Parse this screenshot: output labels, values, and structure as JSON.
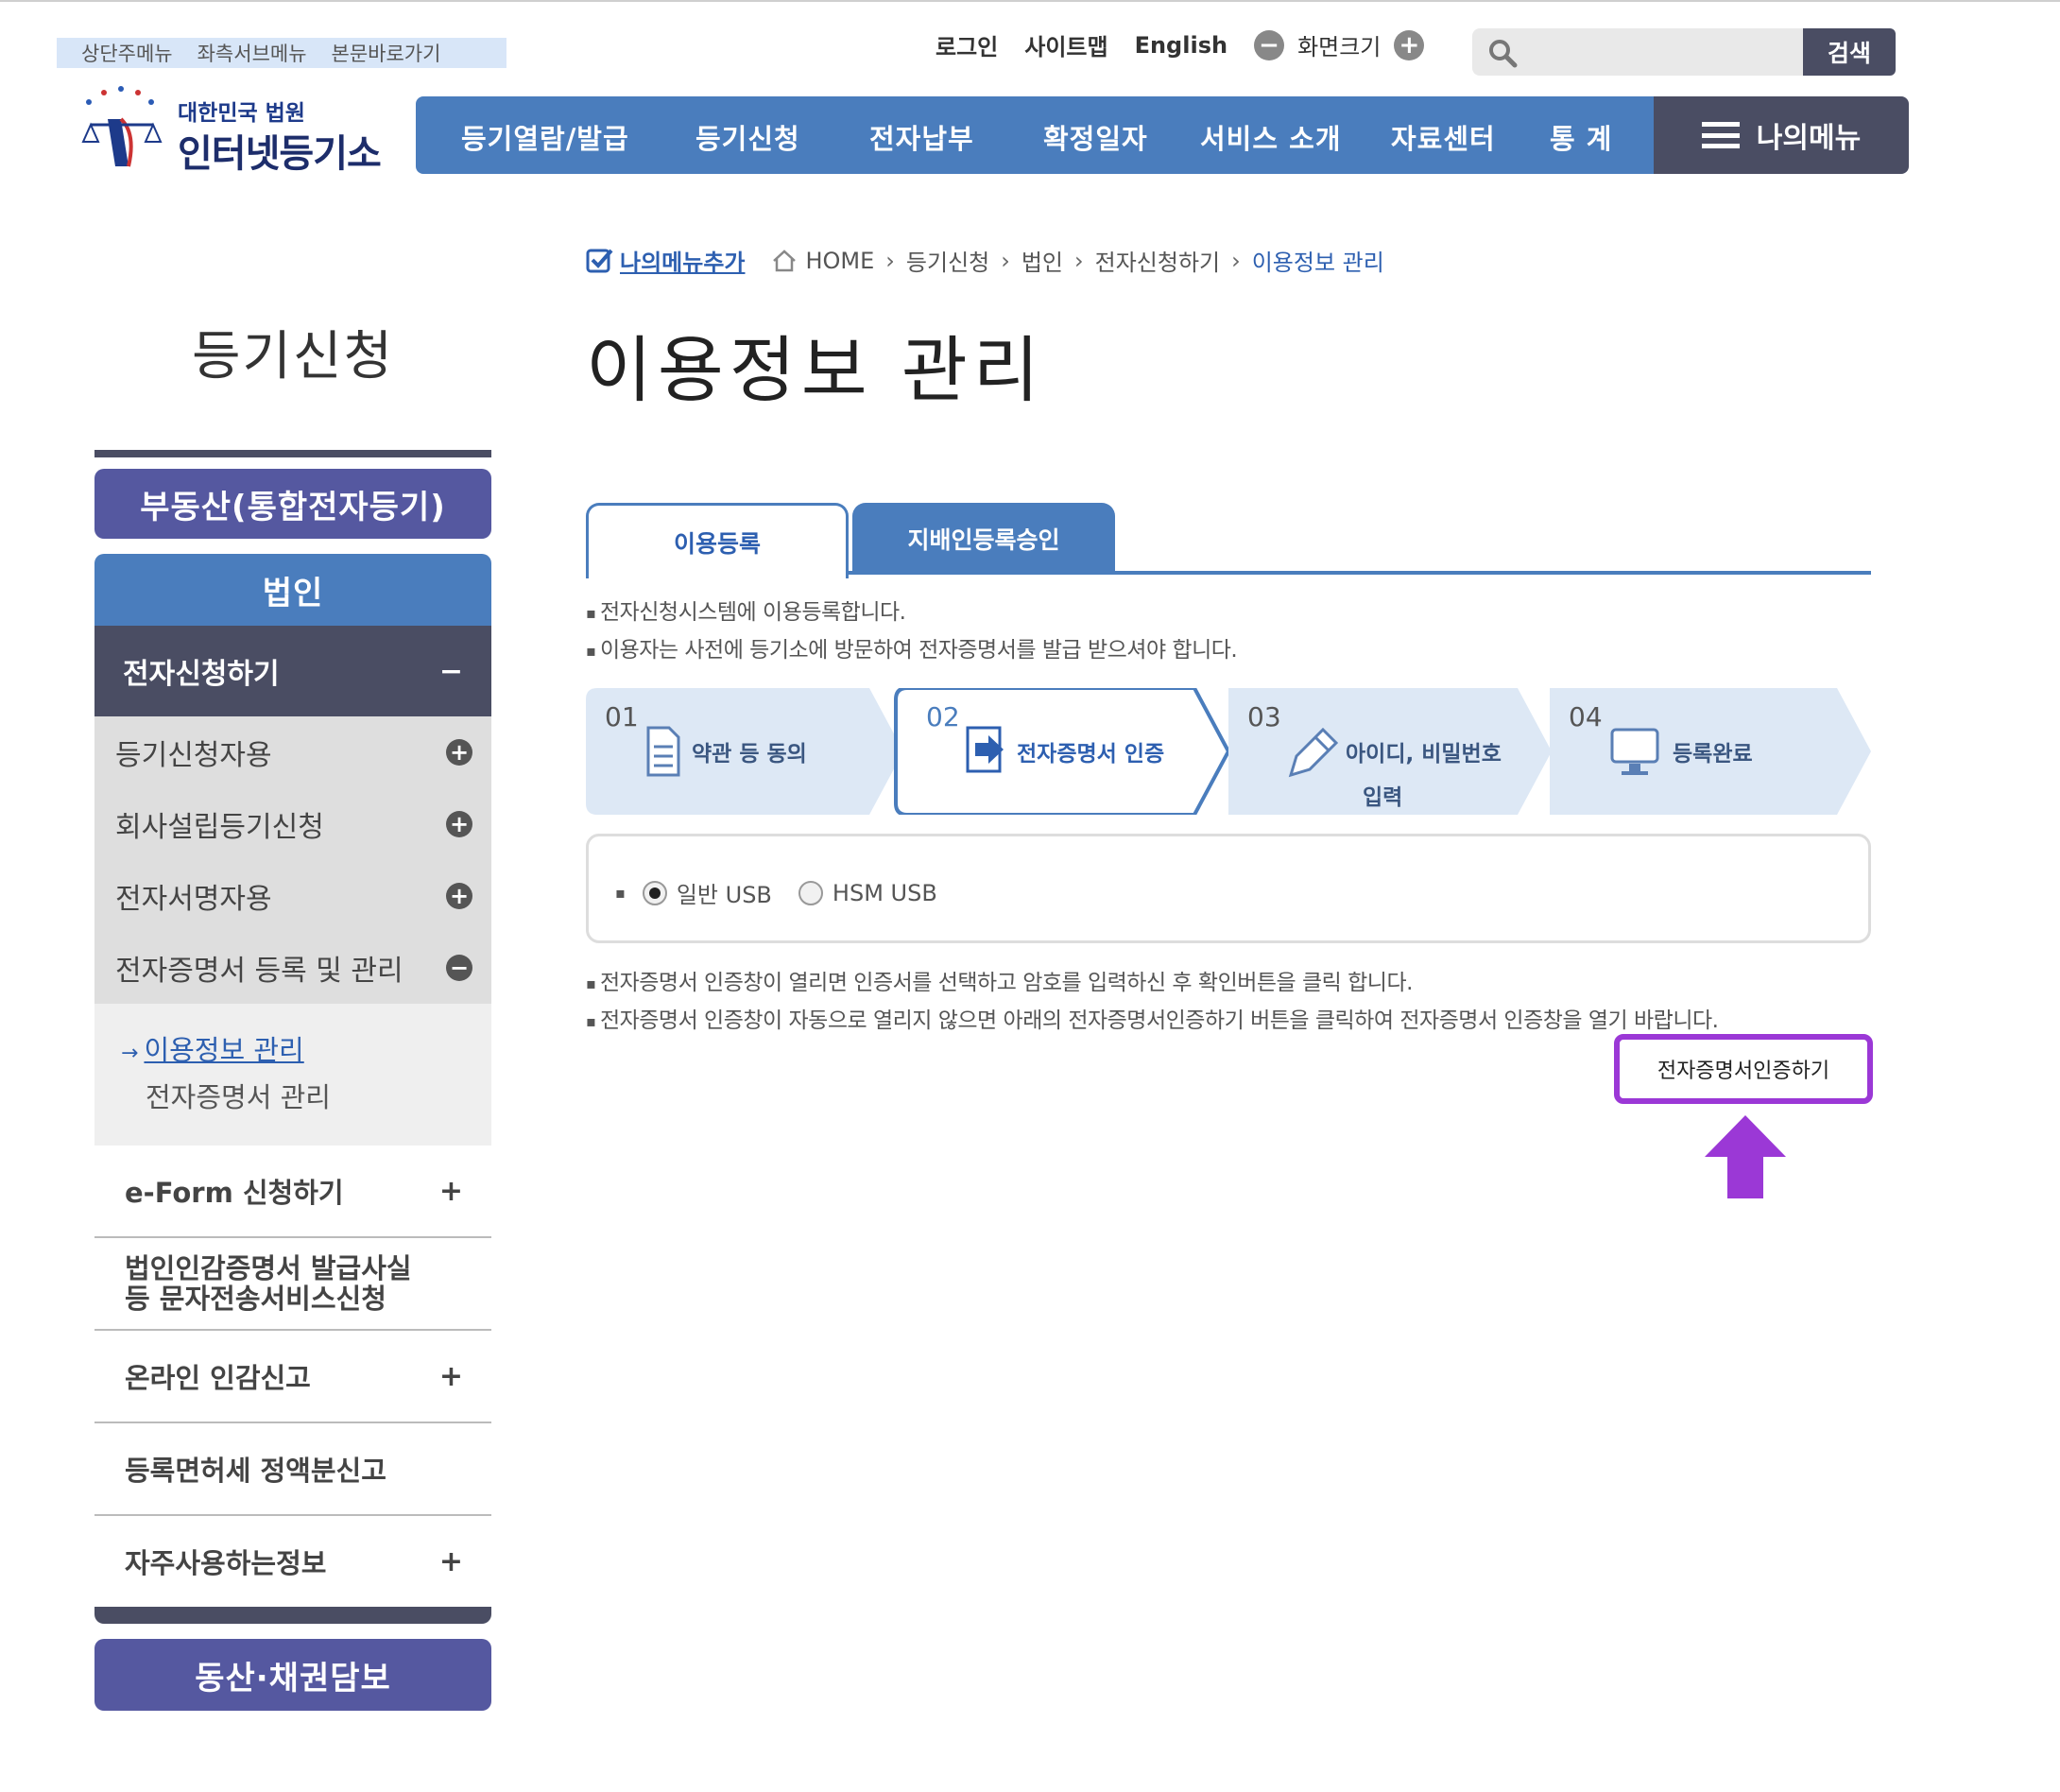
{
  "skip_links": [
    "상단주메뉴",
    "좌측서브메뉴",
    "본문바로가기"
  ],
  "util": {
    "login": "로그인",
    "sitemap": "사이트맵",
    "english": "English",
    "zoom_label": "화면크기",
    "search_button": "검색"
  },
  "logo": {
    "line1": "대한민국 법원",
    "line2": "인터넷등기소"
  },
  "gnb": [
    "등기열람/발급",
    "등기신청",
    "전자납부",
    "확정일자",
    "서비스 소개",
    "자료센터",
    "통 계"
  ],
  "my_menu": "나의메뉴",
  "sidebar": {
    "title": "등기신청",
    "real_estate": "부동산(통합전자등기)",
    "corporation": "법인",
    "expanded": {
      "label": "전자신청하기",
      "toggle": "−"
    },
    "sub_items": [
      "등기신청자용",
      "회사설립등기신청",
      "전자서명자용",
      "전자증명서 등록 및 관리"
    ],
    "leaf_items": [
      "이용정보 관리",
      "전자증명서 관리"
    ],
    "leaf_prefix": "→",
    "menus": [
      {
        "label": "e-Form 신청하기",
        "toggle": "+"
      },
      {
        "label": "법인인감증명서 발급사실 등 문자전송서비스신청",
        "toggle": ""
      },
      {
        "label": "온라인 인감신고",
        "toggle": "+"
      },
      {
        "label": "등록면허세 정액분신고",
        "toggle": ""
      },
      {
        "label": "자주사용하는정보",
        "toggle": "+"
      }
    ],
    "movable": "동산·채권담보"
  },
  "breadcrumb": {
    "add_menu": "나의메뉴추가",
    "items": [
      "HOME",
      "등기신청",
      "법인",
      "전자신청하기"
    ],
    "current": "이용정보 관리"
  },
  "page_title": "이용정보 관리",
  "tabs": [
    "이용등록",
    "지배인등록승인"
  ],
  "notes_top": [
    "전자신청시스템에 이용등록합니다.",
    "이용자는 사전에 등기소에 방문하여 전자증명서를 발급 받으셔야 합니다."
  ],
  "steps": [
    {
      "num": "01",
      "label": "약관 등 동의"
    },
    {
      "num": "02",
      "label": "전자증명서 인증"
    },
    {
      "num": "03",
      "label": "아이디, 비밀번호",
      "label2": "입력"
    },
    {
      "num": "04",
      "label": "등록완료"
    }
  ],
  "usb_options": [
    "일반 USB",
    "HSM USB"
  ],
  "selected_usb": "일반 USB",
  "notes_bottom": [
    "전자증명서 인증창이 열리면 인증서를 선택하고 암호를 입력하신 후 확인버튼을 클릭 합니다.",
    "전자증명서 인증창이 자동으로 열리지 않으면 아래의 전자증명서인증하기 버튼을 클릭하여 전자증명서 인증창을 열기 바랍니다."
  ],
  "cert_button": "전자증명서인증하기",
  "colors": {
    "primary_blue": "#4a7dbd",
    "dark_slate": "#4a4d63",
    "purple_nav": "#5558a0",
    "highlight": "#9b38d6"
  }
}
